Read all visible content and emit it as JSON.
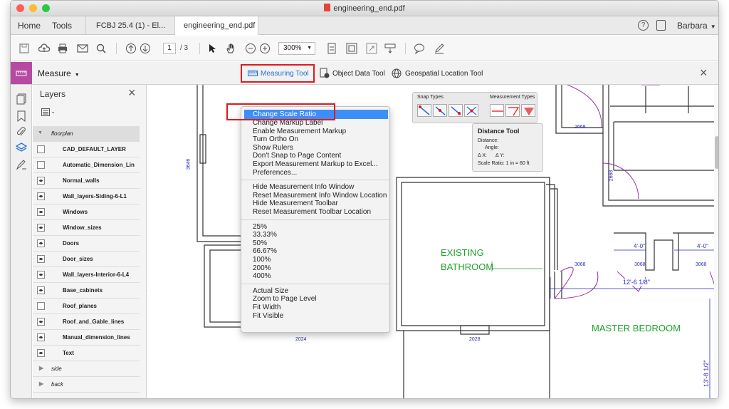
{
  "window": {
    "title": "engineering_end.pdf"
  },
  "tabs": {
    "home": "Home",
    "tools": "Tools",
    "doc1": "FCBJ 25.4 (1) - El...",
    "doc2": "engineering_end.pdf",
    "close": "×",
    "user": "Barbara"
  },
  "toolbar": {
    "page_current": "1",
    "page_total": "/ 3",
    "zoom": "300%"
  },
  "measure": {
    "label": "Measure",
    "measuring_tool": "Measuring Tool",
    "object_data_tool": "Object Data Tool",
    "geospatial_tool": "Geospatial Location Tool",
    "close": "×"
  },
  "layers": {
    "title": "Layers",
    "close": "×",
    "group_floorplan": "floorplan",
    "items": [
      {
        "name": "CAD_DEFAULT_LAYER",
        "visible": false
      },
      {
        "name": "Automatic_Dimension_Lin",
        "visible": false
      },
      {
        "name": "Normal_walls",
        "visible": true
      },
      {
        "name": "Wall_layers-Siding-6-L1",
        "visible": true
      },
      {
        "name": "Windows",
        "visible": true
      },
      {
        "name": "Window_sizes",
        "visible": true
      },
      {
        "name": "Doors",
        "visible": true
      },
      {
        "name": "Door_sizes",
        "visible": true
      },
      {
        "name": "Wall_layers-Interior-6-L4",
        "visible": true
      },
      {
        "name": "Base_cabinets",
        "visible": true
      },
      {
        "name": "Roof_planes",
        "visible": false
      },
      {
        "name": "Roof_and_Gable_lines",
        "visible": true
      },
      {
        "name": "Manual_dimension_lines",
        "visible": true
      },
      {
        "name": "Text",
        "visible": true
      }
    ],
    "group_side": "side",
    "group_back": "back"
  },
  "context_menu": {
    "change_scale": "Change Scale Ratio",
    "group1": [
      "Change Markup Label",
      "Enable Measurement Markup",
      "Turn Ortho On",
      "Show Rulers",
      "Don't Snap to Page Content",
      "Export Measurement Markup to Excel...",
      "Preferences..."
    ],
    "group2": [
      "Hide Measurement Info Window",
      "Reset Measurement Info Window Location",
      "Hide Measurement Toolbar",
      "Reset Measurement Toolbar Location"
    ],
    "group3": [
      "25%",
      "33.33%",
      "50%",
      "66.67%",
      "100%",
      "200%",
      "400%"
    ],
    "group4": [
      "Actual Size",
      "Zoom to Page Level",
      "Fit Width",
      "Fit Visible"
    ]
  },
  "snap_panel": {
    "snap_types": "Snap Types",
    "measurement_types": "Measurement Types"
  },
  "distance_tool": {
    "title": "Distance Tool",
    "distance": "Distance:",
    "angle": "Angle:",
    "dx": "Δ X:",
    "dy": "Δ Y:",
    "scale": "Scale Ratio:  1 in = 60 ft"
  },
  "drawing": {
    "bathroom_line1": "EXISTING",
    "bathroom_line2": "BATHROOM",
    "master_bedroom": "MASTER BEDROOM",
    "dim_3646": "3646",
    "dim_2668a": "2668",
    "dim_2668b": "2668",
    "dim_4_0a": "4'-0\"",
    "dim_4_0b": "4'-0\"",
    "dim_3068a": "3068",
    "dim_3068b": "3068",
    "dim_3068c": "3068",
    "dim_12_6": "12'-6 1/8\"",
    "dim_2024": "2024",
    "dim_2028": "2028",
    "dim_13_8": "13'-8 1/2\""
  },
  "colors": {
    "highlight_red": "#e0191f",
    "menu_selected": "#3d8ef7",
    "accent_blue": "#2a6ed8",
    "green_text": "#1fa12b",
    "purple_line": "#9a2fa8"
  }
}
